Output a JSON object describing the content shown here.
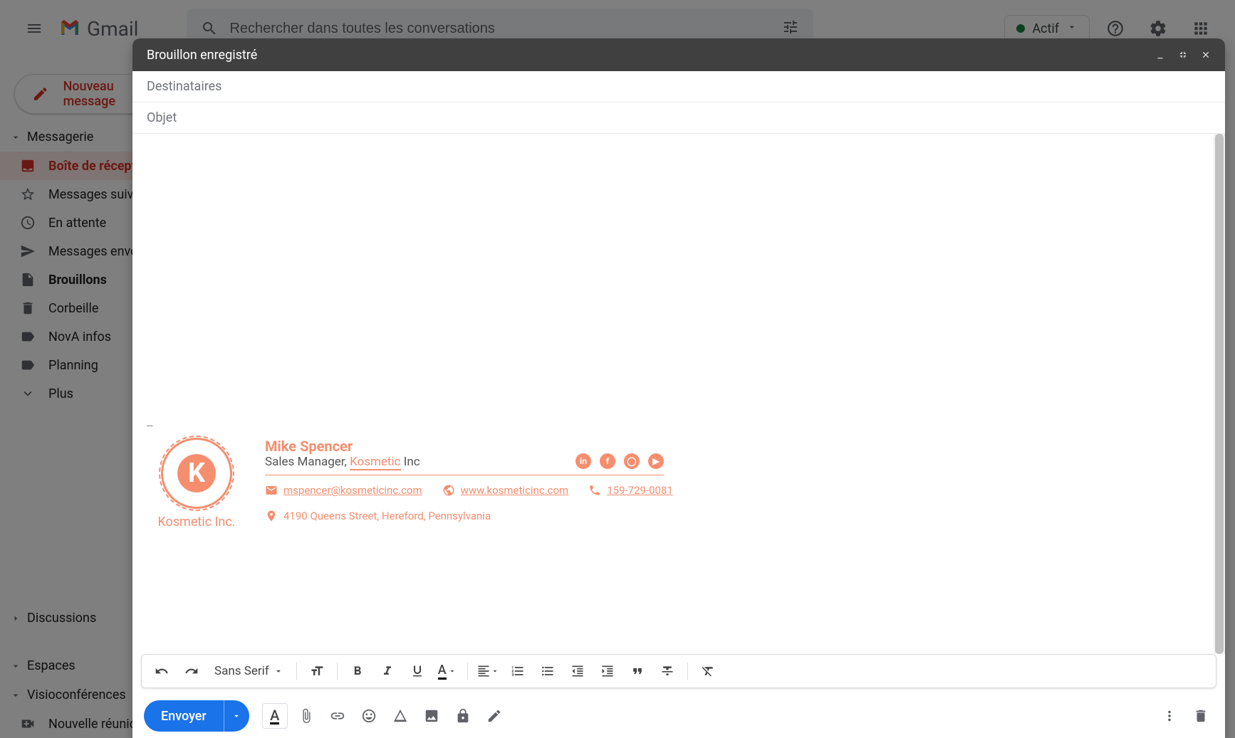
{
  "header": {
    "brand": "Gmail",
    "search_placeholder": "Rechercher dans toutes les conversations",
    "status": "Actif"
  },
  "sidebar": {
    "compose": "Nouveau message",
    "messagerie": "Messagerie",
    "discussions": "Discussions",
    "espaces": "Espaces",
    "visio": "Visioconférences",
    "new_meeting": "Nouvelle réunion",
    "folders": [
      {
        "label": "Boîte de réception"
      },
      {
        "label": "Messages suivis"
      },
      {
        "label": "En attente"
      },
      {
        "label": "Messages envoyés"
      },
      {
        "label": "Brouillons"
      },
      {
        "label": "Corbeille"
      },
      {
        "label": "NovA infos"
      },
      {
        "label": "Planning"
      },
      {
        "label": "Plus"
      }
    ]
  },
  "compose": {
    "title": "Brouillon enregistré",
    "recipients": "Destinataires",
    "subject": "Objet",
    "separator": "--",
    "font": "Sans Serif",
    "send": "Envoyer"
  },
  "signature": {
    "brand": "Kosmetic Inc.",
    "logo_letter": "K",
    "name": "Mike Spencer",
    "title_pre": "Sales Manager, ",
    "company": "Kosmetic",
    "title_post": " Inc",
    "email": "mspencer@kosmeticinc.com",
    "website": "www.kosmeticinc.com",
    "phone": "159-729-0081",
    "address": "4190 Queens Street, Hereford, Pennsylvania"
  }
}
